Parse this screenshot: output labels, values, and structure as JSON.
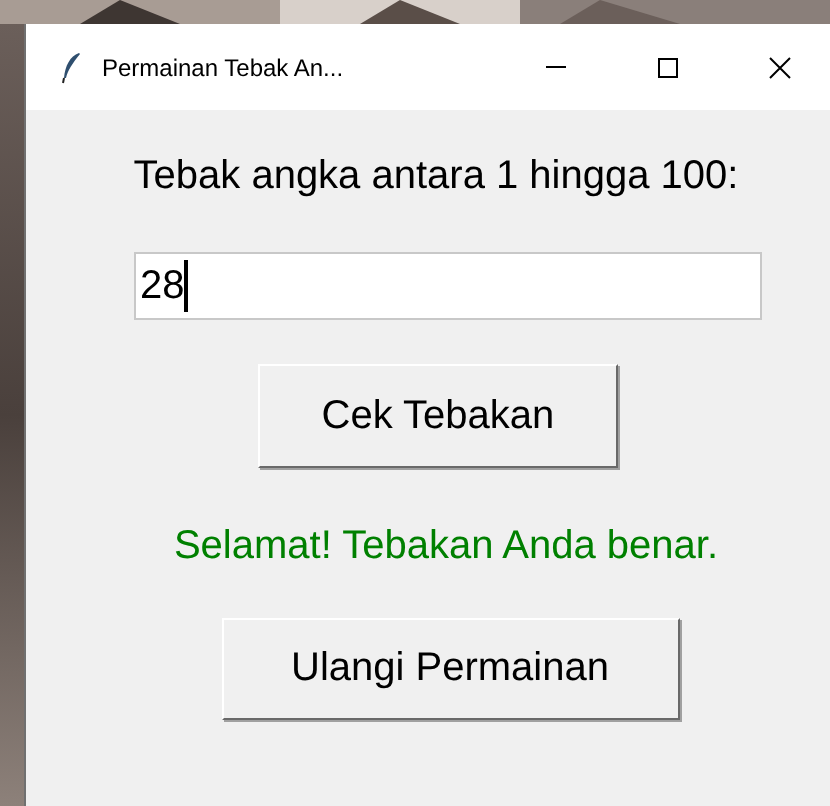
{
  "window": {
    "title": "Permainan Tebak An..."
  },
  "prompt": "Tebak angka antara 1 hingga 100:",
  "guess_field": {
    "value": "28",
    "focused": true
  },
  "check_button": "Cek Tebakan",
  "message": {
    "text": "Selamat! Tebakan Anda benar.",
    "kind": "success"
  },
  "restart_button": "Ulangi Permainan"
}
